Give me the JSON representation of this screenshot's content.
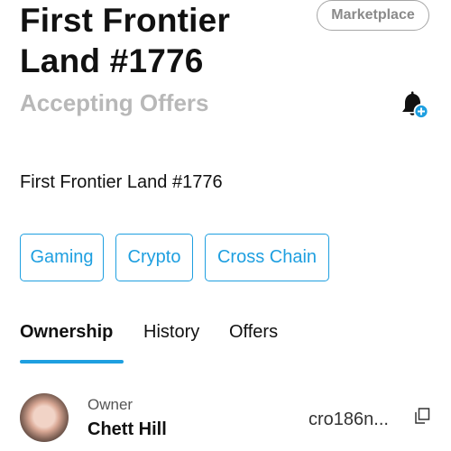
{
  "header": {
    "title_line1": "First Frontier",
    "title_line2": "Land #1776",
    "marketplace_label": "Marketplace",
    "status": "Accepting Offers",
    "bell_icon": "bell-plus-icon"
  },
  "description": "First Frontier Land #1776",
  "tags": [
    "Gaming",
    "Crypto",
    "Cross Chain"
  ],
  "tabs": [
    {
      "label": "Ownership",
      "active": true
    },
    {
      "label": "History",
      "active": false
    },
    {
      "label": "Offers",
      "active": false
    }
  ],
  "owner": {
    "label": "Owner",
    "name": "Chett Hill",
    "address": "cro186n...",
    "copy_icon": "copy-icon"
  },
  "colors": {
    "accent": "#1e9fe0",
    "muted": "#b8b8b8"
  }
}
